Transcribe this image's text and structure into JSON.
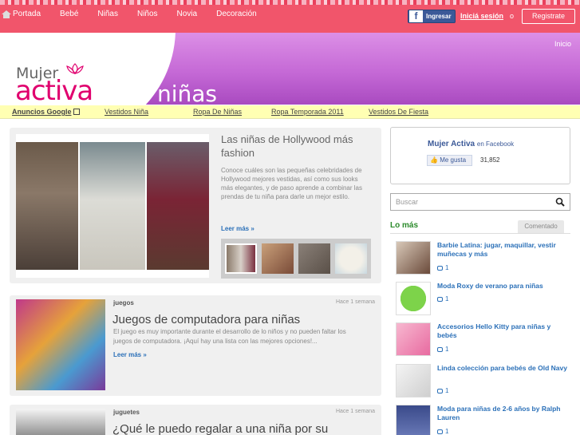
{
  "nav": {
    "home": "Portada",
    "items": [
      "Bebé",
      "Niñas",
      "Niños",
      "Novia",
      "Decoración"
    ],
    "facebook_login": "Ingresar",
    "signin": "Iniciá sesión",
    "or": "o",
    "register": "Registrate"
  },
  "header": {
    "logo_top": "Mujer",
    "logo_bottom": "activa",
    "section": "niñas",
    "home_link": "Inicio"
  },
  "adbar": {
    "label": "Anuncios Google",
    "links": [
      "Vestidos Niña",
      "Ropa De Niñas",
      "Ropa Temporada 2011",
      "Vestidos De Fiesta"
    ]
  },
  "featured": {
    "title": "Las niñas de Hollywood más fashion",
    "text": "Conoce cuáles son las pequeñas celebridades de Hollywood mejores vestidas, así como sus looks más elegantes, y de paso aprende a combinar las prendas de tu niña para darle un mejor estilo.",
    "readmore": "Leer más »"
  },
  "posts": [
    {
      "category": "juegos",
      "time": "Hace 1 semana",
      "title": "Juegos de computadora para niñas",
      "excerpt": "El juego es muy importante durante el desarrollo de lo niños y no pueden faltar los juegos de computadora. ¡Aquí hay una lista con las mejores opciones!...",
      "readmore": "Leer más »"
    },
    {
      "category": "juguetes",
      "time": "Hace 1 semana",
      "title": "¿Qué le puedo regalar a una niña por su"
    }
  ],
  "sidebar": {
    "fb_name": "Mujer Activa",
    "fb_on": "en Facebook",
    "like": "Me gusta",
    "like_count": "31,852",
    "search_placeholder": "Buscar",
    "most_label": "Lo más",
    "tab_commented": "Comentado",
    "items": [
      {
        "title": "Barbie Latina: jugar, maquillar, vestir muñecas y más",
        "comments": "1"
      },
      {
        "title": "Moda Roxy de verano para niñas",
        "comments": "1"
      },
      {
        "title": "Accesorios Hello Kitty para niñas y bebés",
        "comments": "1"
      },
      {
        "title": "Linda colección para bebés de Old Navy",
        "comments": "1"
      },
      {
        "title": "Moda para niñas de 2-6 años by Ralph Lauren",
        "comments": "1"
      }
    ]
  },
  "colors": {
    "nav_bg": "#f1556b",
    "banner": "#c569d6",
    "brand": "#e0006e",
    "link": "#2b70b8"
  }
}
